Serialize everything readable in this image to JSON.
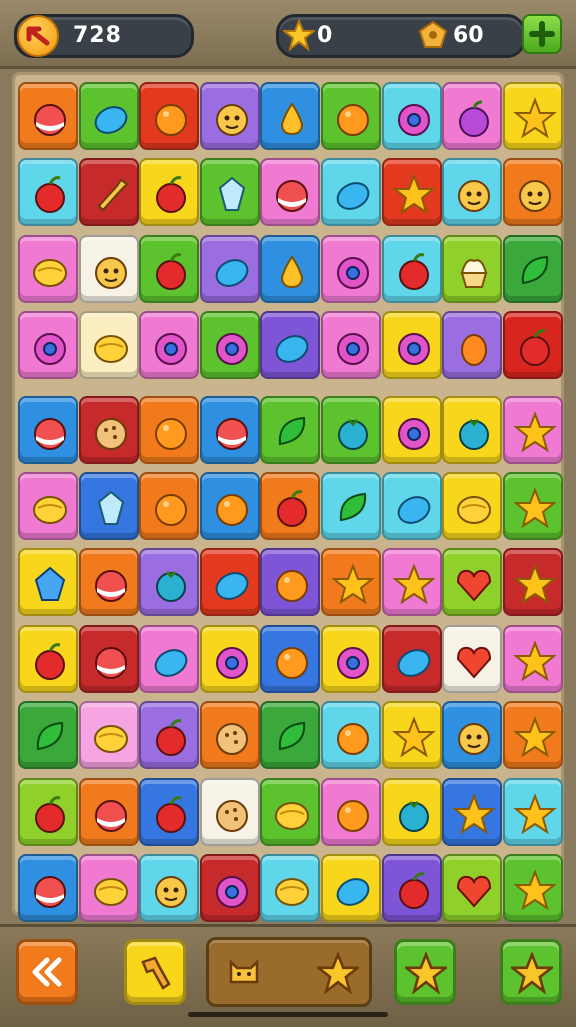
{
  "header": {
    "moves_value": "728",
    "stars_value": "0",
    "gems_value": "60",
    "back_icon": "back-arrow-icon",
    "star_icon": "star-icon",
    "gem_icon": "gem-icon",
    "add_icon": "plus-icon"
  },
  "board": {
    "columns": 9,
    "rows": 11,
    "tiles": [
      [
        "orange",
        "#f07a1c",
        "candy"
      ],
      [
        "green",
        "#5cc22d",
        "bean"
      ],
      [
        "red",
        "#e2391f",
        "orange"
      ],
      [
        "purple",
        "#9a6de0",
        "face"
      ],
      [
        "blue",
        "#2f8fe0",
        "pear"
      ],
      [
        "green",
        "#5cc22d",
        "orange"
      ],
      [
        "cyan",
        "#5fd6ea",
        "donut"
      ],
      [
        "pink",
        "#f07ad2",
        "plum"
      ],
      [
        "yellow",
        "#f7d61c",
        "star"
      ],
      [
        "cyan",
        "#5fd6ea",
        "apple"
      ],
      [
        "darkred",
        "#c62a2a",
        "wrench"
      ],
      [
        "yellow",
        "#f7d61c",
        "apple"
      ],
      [
        "green",
        "#5cc22d",
        "crystal"
      ],
      [
        "pink",
        "#f07ad2",
        "candy"
      ],
      [
        "cyan",
        "#5fd6ea",
        "bean"
      ],
      [
        "red",
        "#e2391f",
        "star"
      ],
      [
        "cyan",
        "#5fd6ea",
        "face"
      ],
      [
        "orange",
        "#f07a1c",
        "face"
      ],
      [
        "pink",
        "#f07ad2",
        "lemon"
      ],
      [
        "white",
        "#f6f2e6",
        "face"
      ],
      [
        "green",
        "#5cc22d",
        "apple"
      ],
      [
        "purple",
        "#9a6de0",
        "bean"
      ],
      [
        "blue",
        "#2f8fe0",
        "pear"
      ],
      [
        "pink",
        "#f07ad2",
        "donut"
      ],
      [
        "cyan",
        "#5fd6ea",
        "apple"
      ],
      [
        "lime",
        "#8fd12a",
        "cupcake"
      ],
      [
        "green",
        "#3aa83a",
        "leaf"
      ],
      [
        "pink",
        "#f07ad2",
        "donut"
      ],
      [
        "cream",
        "#fbeec0",
        "lemon"
      ],
      [
        "pink",
        "#f07ad2",
        "donut"
      ],
      [
        "green",
        "#5cc22d",
        "donut"
      ],
      [
        "purple",
        "#7d55d6",
        "bean"
      ],
      [
        "pink",
        "#f07ad2",
        "donut"
      ],
      [
        "yellow",
        "#f7d61c",
        "donut"
      ],
      [
        "purple",
        "#9a6de0",
        "egg"
      ],
      [
        "red",
        "#d8261e",
        "apple"
      ],
      [
        "blue",
        "#2f8fe0",
        "candy"
      ],
      [
        "darkred",
        "#c62a2a",
        "cookie"
      ],
      [
        "orange",
        "#f07a1c",
        "orange"
      ],
      [
        "blue",
        "#2f8fe0",
        "candy"
      ],
      [
        "green",
        "#5cc22d",
        "leaf"
      ],
      [
        "green",
        "#5cc22d",
        "berry"
      ],
      [
        "yellow",
        "#f7d61c",
        "donut"
      ],
      [
        "yellow",
        "#f7d61c",
        "berry"
      ],
      [
        "pink",
        "#f07ad2",
        "star"
      ],
      [
        "pink",
        "#f07ad2",
        "lemon"
      ],
      [
        "blue",
        "#3576e0",
        "crystal"
      ],
      [
        "orange",
        "#f07a1c",
        "orange"
      ],
      [
        "blue",
        "#2f8fe0",
        "orange"
      ],
      [
        "orange",
        "#f07a1c",
        "apple"
      ],
      [
        "cyan",
        "#5fd6ea",
        "leaf"
      ],
      [
        "cyan",
        "#5fd6ea",
        "bean"
      ],
      [
        "yellow",
        "#f7d61c",
        "lemon"
      ],
      [
        "green",
        "#5cc22d",
        "star"
      ],
      [
        "yellow",
        "#f7d61c",
        "gem"
      ],
      [
        "orange",
        "#f07a1c",
        "candy"
      ],
      [
        "purple",
        "#9a6de0",
        "berry"
      ],
      [
        "red",
        "#e2391f",
        "bean"
      ],
      [
        "purple",
        "#7d55d6",
        "orange"
      ],
      [
        "orange",
        "#f07a1c",
        "star"
      ],
      [
        "pink",
        "#f07ad2",
        "star"
      ],
      [
        "lime",
        "#8fd12a",
        "heart"
      ],
      [
        "darkred",
        "#c62a2a",
        "star"
      ],
      [
        "yellow",
        "#f7d61c",
        "apple"
      ],
      [
        "darkred",
        "#c62a2a",
        "candy"
      ],
      [
        "pink",
        "#f07ad2",
        "bean"
      ],
      [
        "yellow",
        "#f7d61c",
        "donut"
      ],
      [
        "blue",
        "#3576e0",
        "orange"
      ],
      [
        "yellow",
        "#f7d61c",
        "donut"
      ],
      [
        "darkred",
        "#c62a2a",
        "bean"
      ],
      [
        "white",
        "#f6f2e6",
        "heart"
      ],
      [
        "pink",
        "#f07ad2",
        "star"
      ],
      [
        "green",
        "#3aa83a",
        "leaf"
      ],
      [
        "pink",
        "#f7a4e2",
        "lemon"
      ],
      [
        "purple",
        "#9a6de0",
        "apple"
      ],
      [
        "orange",
        "#f07a1c",
        "cookie"
      ],
      [
        "green",
        "#3aa83a",
        "leaf"
      ],
      [
        "cyan",
        "#5fd6ea",
        "orange"
      ],
      [
        "yellow",
        "#f7d61c",
        "star"
      ],
      [
        "blue",
        "#2f8fe0",
        "face"
      ],
      [
        "orange",
        "#f07a1c",
        "star"
      ],
      [
        "lime",
        "#8fd12a",
        "apple"
      ],
      [
        "orange",
        "#f07a1c",
        "candy"
      ],
      [
        "blue",
        "#3576e0",
        "apple"
      ],
      [
        "white",
        "#f6f2e6",
        "cookie"
      ],
      [
        "green",
        "#5cc22d",
        "lemon"
      ],
      [
        "pink",
        "#f07ad2",
        "orange"
      ],
      [
        "yellow",
        "#f7d61c",
        "berry"
      ],
      [
        "blue",
        "#3576e0",
        "star"
      ],
      [
        "cyan",
        "#5fd6ea",
        "star"
      ],
      [
        "blue",
        "#2f8fe0",
        "candy"
      ],
      [
        "pink",
        "#f07ad2",
        "lemon"
      ],
      [
        "cyan",
        "#5fd6ea",
        "face"
      ],
      [
        "darkred",
        "#c62a2a",
        "donut"
      ],
      [
        "cyan",
        "#5fd6ea",
        "lemon"
      ],
      [
        "yellow",
        "#f7d61c",
        "bean"
      ],
      [
        "purple",
        "#7d55d6",
        "apple"
      ],
      [
        "lime",
        "#8fd12a",
        "heart"
      ],
      [
        "green",
        "#5cc22d",
        "star"
      ]
    ]
  },
  "footer": {
    "buttons": [
      {
        "name": "rewind-button",
        "icon": "rewind-icon",
        "color": "#f07a1c"
      },
      {
        "name": "hammer-button",
        "icon": "hammer-icon",
        "color": "#f7d61c"
      },
      {
        "name": "shuffle-button",
        "icon": "star-icon",
        "color": "#5cc22d"
      },
      {
        "name": "hint-button",
        "icon": "star-icon",
        "color": "#5cc22d"
      }
    ],
    "booster_icons": [
      "cat-icon",
      "star-icon"
    ]
  }
}
